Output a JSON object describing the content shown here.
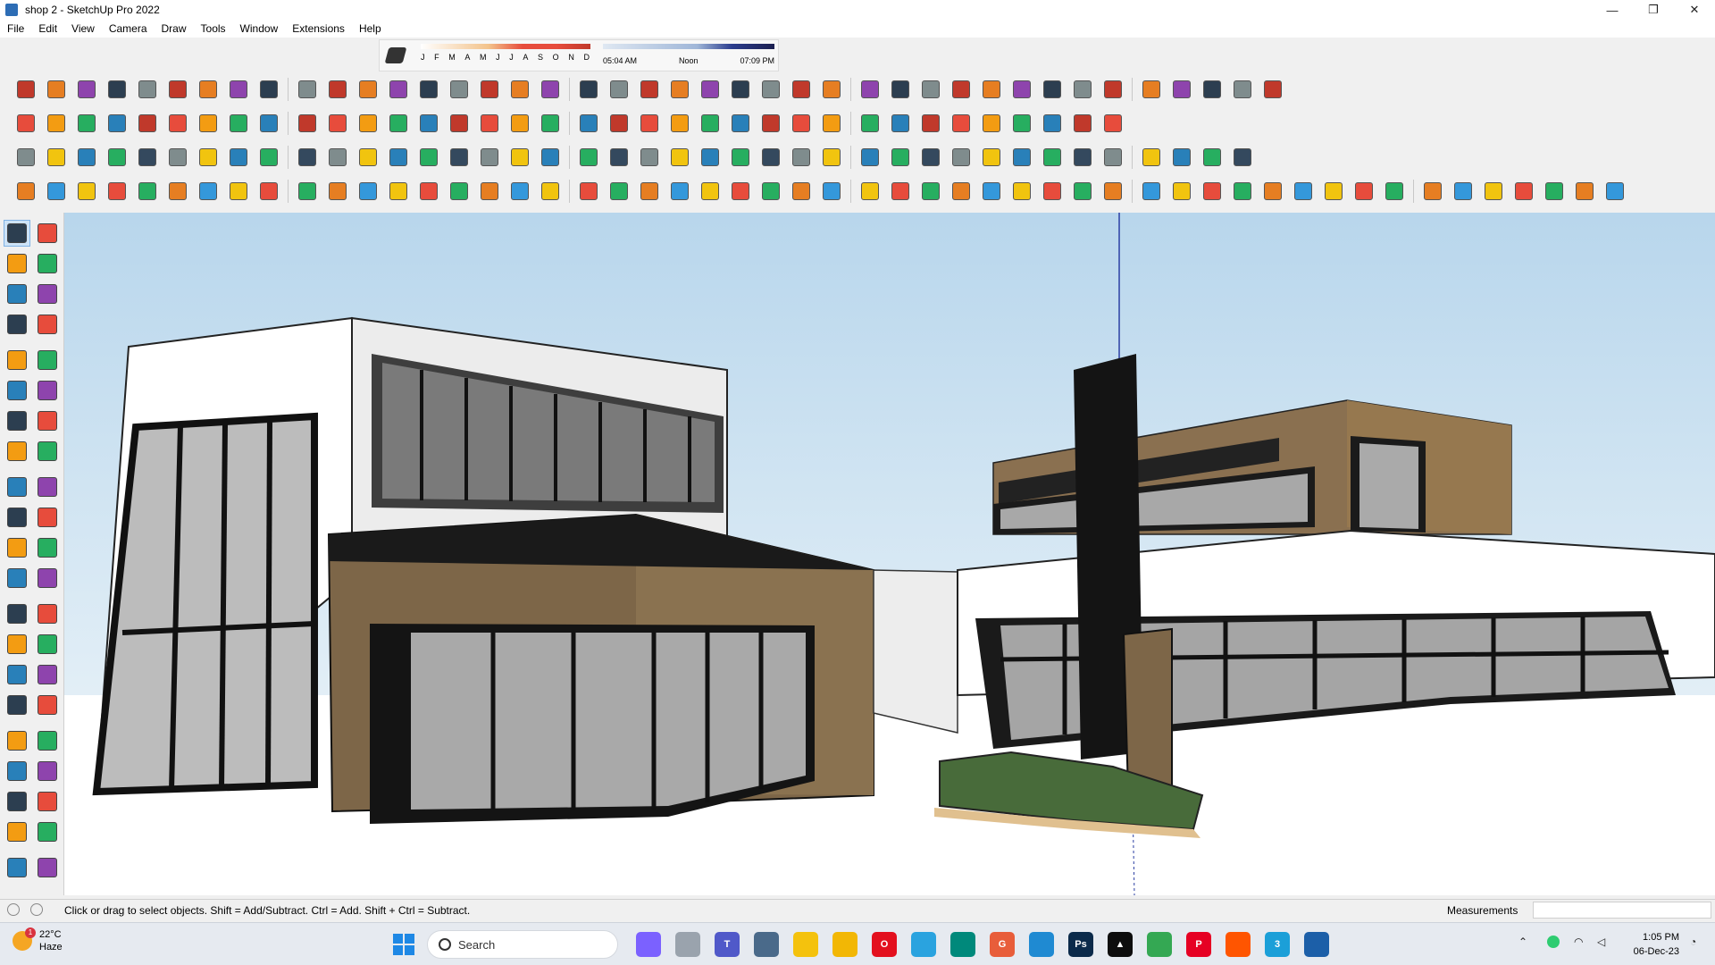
{
  "window": {
    "title": "shop 2 - SketchUp Pro 2022",
    "min": "—",
    "max": "❐",
    "close": "✕"
  },
  "menu": [
    "File",
    "Edit",
    "View",
    "Camera",
    "Draw",
    "Tools",
    "Window",
    "Extensions",
    "Help"
  ],
  "shadows": {
    "months": [
      "J",
      "F",
      "M",
      "A",
      "M",
      "J",
      "J",
      "A",
      "S",
      "O",
      "N",
      "D"
    ],
    "sunrise": "05:04 AM",
    "noon": "Noon",
    "sunset": "07:09 PM"
  },
  "toolbar_rows": [
    {
      "count": 41,
      "colors": [
        "#c0392b",
        "#e67e22",
        "#8e44ad",
        "#2c3e50",
        "#7f8c8d"
      ]
    },
    {
      "count": 36,
      "colors": [
        "#e74c3c",
        "#f39c12",
        "#27ae60",
        "#2980b9",
        "#c0392b"
      ]
    },
    {
      "count": 40,
      "colors": [
        "#7f8c8d",
        "#f1c40f",
        "#2980b9",
        "#27ae60",
        "#34495e"
      ]
    },
    {
      "count": 52,
      "colors": [
        "#e67e22",
        "#3498db",
        "#f1c40f",
        "#e74c3c",
        "#27ae60"
      ]
    }
  ],
  "left_tools": [
    "select-icon",
    "orbit-icon",
    "paint-bucket-icon",
    "eraser-icon",
    "component-icon",
    "tape-icon",
    "line-icon",
    "freehand-icon",
    "rectangle-icon",
    "rotated-rectangle-icon",
    "circle-icon",
    "polygon-icon",
    "arc-icon",
    "two-point-arc-icon",
    "three-point-arc-icon",
    "pie-icon",
    "move-icon",
    "push-pull-icon",
    "rotate-icon",
    "follow-me-icon",
    "scale-icon",
    "offset-icon",
    "tape-measure-icon",
    "dimension-icon",
    "protractor-icon",
    "text-icon",
    "axes-icon",
    "3d-text-icon",
    "orbit-2-icon",
    "pan-icon",
    "zoom-icon",
    "zoom-window-icon",
    "zoom-extents-icon",
    "previous-view-icon",
    "position-camera-icon",
    "look-around-icon",
    "walk-icon",
    "section-plane-icon",
    "sandbox-icon",
    "smoove-icon",
    "stamp-icon",
    "drape-icon"
  ],
  "status": {
    "hint": "Click or drag to select objects. Shift = Add/Subtract. Ctrl = Add. Shift + Ctrl = Subtract.",
    "measurements_label": "Measurements",
    "measurements_value": ""
  },
  "taskbar": {
    "temp": "22°C",
    "condition": "Haze",
    "weather_badge": "1",
    "search": "Search",
    "time": "1:05 PM",
    "date": "06-Dec-23",
    "apps": [
      {
        "name": "copilot-icon",
        "color": "#7b61ff",
        "label": ""
      },
      {
        "name": "file-explorer-task-icon",
        "color": "#9aa3ad",
        "label": ""
      },
      {
        "name": "teams-icon",
        "color": "#5059c9",
        "label": "T"
      },
      {
        "name": "calculator-icon",
        "color": "#4a6a8a",
        "label": ""
      },
      {
        "name": "sticky-notes-icon",
        "color": "#f4c20d",
        "label": ""
      },
      {
        "name": "folder-icon",
        "color": "#f2b705",
        "label": ""
      },
      {
        "name": "opera-icon",
        "color": "#e3101e",
        "label": "O"
      },
      {
        "name": "telegram-icon",
        "color": "#2aa3df",
        "label": ""
      },
      {
        "name": "terminal-icon",
        "color": "#00897b",
        "label": ""
      },
      {
        "name": "grammarly-icon",
        "color": "#e85d3a",
        "label": "G"
      },
      {
        "name": "vscode-icon",
        "color": "#1f8ad2",
        "label": ""
      },
      {
        "name": "photoshop-icon",
        "color": "#0b2a4a",
        "label": "Ps"
      },
      {
        "name": "autodesk-icon",
        "color": "#0d0d0d",
        "label": "▲"
      },
      {
        "name": "chrome-icon",
        "color": "#34a853",
        "label": ""
      },
      {
        "name": "pinterest-icon",
        "color": "#e60023",
        "label": "P"
      },
      {
        "name": "soundcloud-icon",
        "color": "#ff5500",
        "label": ""
      },
      {
        "name": "app-3-icon",
        "color": "#1b9fd8",
        "label": "3"
      },
      {
        "name": "sketchup-task-icon",
        "color": "#1c5fa8",
        "label": ""
      }
    ]
  }
}
